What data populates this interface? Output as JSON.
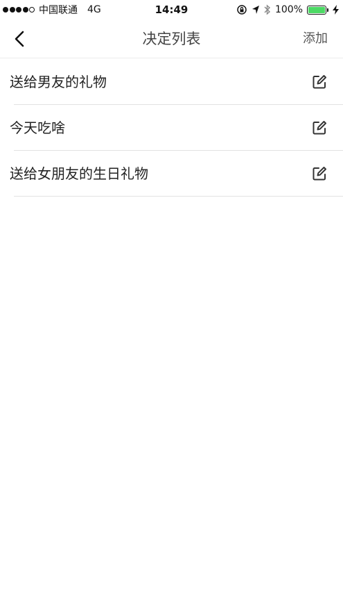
{
  "status_bar": {
    "carrier": "中国联通",
    "network": "4G",
    "time": "14:49",
    "battery_percent": "100%",
    "battery_level": 1.0,
    "battery_color": "#4cd964"
  },
  "nav": {
    "back_icon": "chevron-left-icon",
    "title": "决定列表",
    "add_label": "添加"
  },
  "list": {
    "items": [
      {
        "label": "送给男友的礼物",
        "icon": "edit-icon"
      },
      {
        "label": "今天吃啥",
        "icon": "edit-icon"
      },
      {
        "label": "送给女朋友的生日礼物",
        "icon": "edit-icon"
      }
    ]
  }
}
